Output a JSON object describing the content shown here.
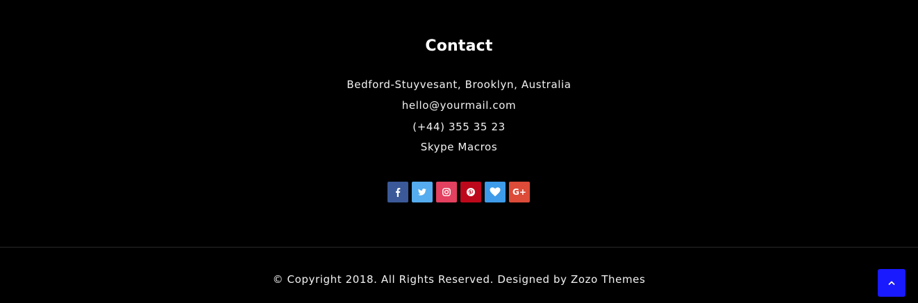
{
  "contact": {
    "title": "Contact",
    "address": "Bedford-Stuyvesant, Brooklyn, Australia",
    "email": "hello@yourmail.com",
    "phone": "(+44) 355 35 23",
    "skype": "Skype Macros"
  },
  "social": [
    {
      "name": "facebook-icon",
      "color": "#3b5998"
    },
    {
      "name": "twitter-icon",
      "color": "#55acee"
    },
    {
      "name": "instagram-icon",
      "color": "#e4405f"
    },
    {
      "name": "pinterest-icon",
      "color": "#bd081c"
    },
    {
      "name": "heart-icon",
      "color": "#3d9be9"
    },
    {
      "name": "google-plus-icon",
      "color": "#dd4b39",
      "glyph": "G+"
    }
  ],
  "footer": {
    "copyright": "© Copyright 2018. All Rights Reserved. Designed by Zozo Themes"
  },
  "back_to_top": {
    "icon": "chevron-up-icon",
    "color": "#1a1aff"
  }
}
